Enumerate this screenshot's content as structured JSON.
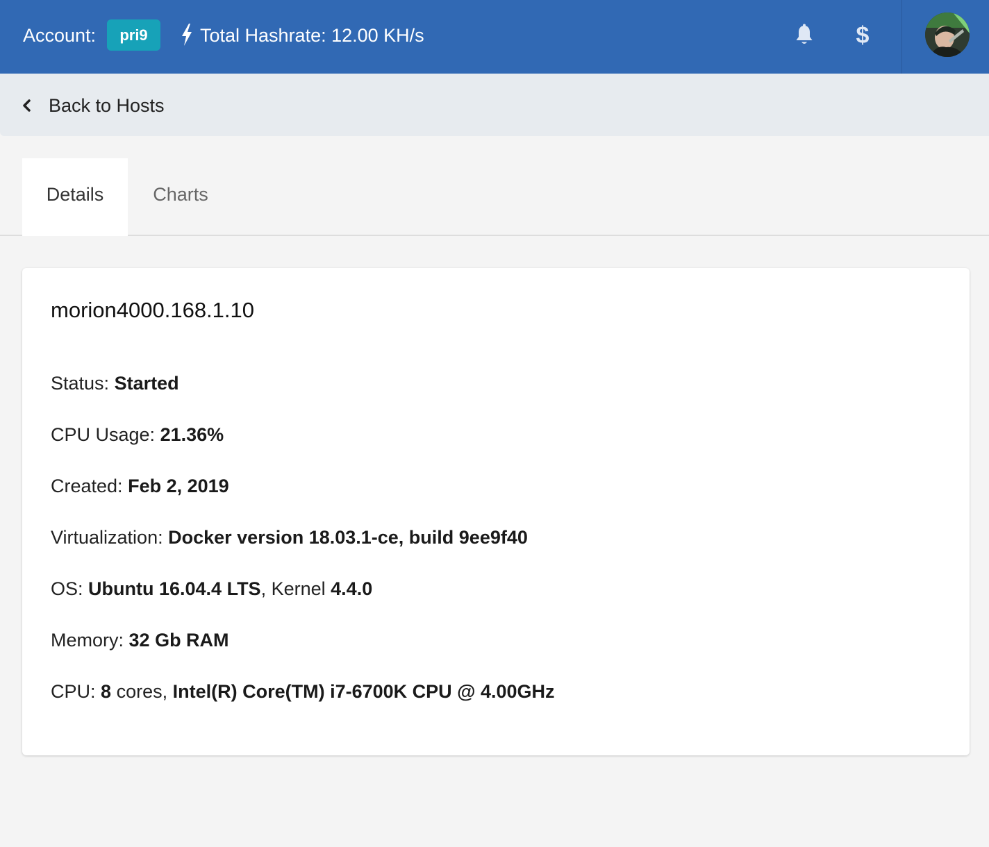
{
  "header": {
    "account_label": "Account:",
    "account_name": "pri9",
    "hashrate_text": "Total Hashrate: 12.00 KH/s",
    "icons": [
      "bolt-icon",
      "bell-icon",
      "dollar-icon"
    ],
    "colors": {
      "topbar": "#3169b4",
      "badge": "#17a2b8"
    }
  },
  "nav": {
    "back_label": "Back to Hosts"
  },
  "tabs": [
    {
      "label": "Details",
      "active": true
    },
    {
      "label": "Charts",
      "active": false
    }
  ],
  "host": {
    "name": "morion4000.168.1.10",
    "status_label": "Status:",
    "status_value": "Started",
    "cpu_usage_label": "CPU Usage:",
    "cpu_usage_value": "21.36%",
    "created_label": "Created:",
    "created_value": "Feb 2, 2019",
    "virtualization_label": "Virtualization:",
    "virtualization_value": "Docker version 18.03.1-ce, build 9ee9f40",
    "os_label": "OS:",
    "os_value": "Ubuntu 16.04.4 LTS",
    "kernel_sep": ", Kernel",
    "kernel_value": "4.4.0",
    "memory_label": "Memory:",
    "memory_value": "32 Gb RAM",
    "cpu_label": "CPU:",
    "cpu_cores": "8",
    "cpu_cores_suffix": "cores,",
    "cpu_model": "Intel(R) Core(TM) i7-6700K CPU @ 4.00GHz"
  }
}
